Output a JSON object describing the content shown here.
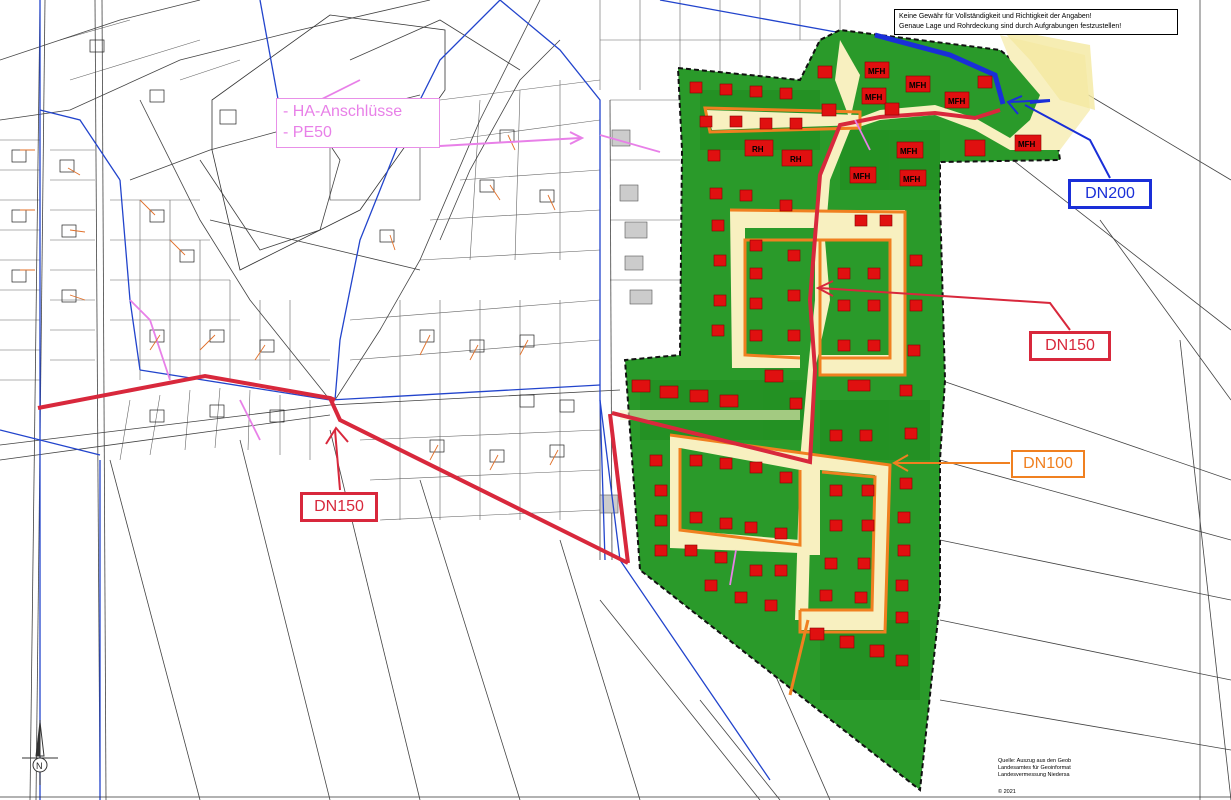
{
  "disclaimer": {
    "line1": "Keine Gewähr für Vollständigkeit und Richtigkeit der Angaben!",
    "line2": "Genaue Lage und Rohrdeckung sind durch Aufgrabungen festzustellen!"
  },
  "legend_ha": {
    "line1": "- HA-Anschlüsse",
    "line2": "- PE50"
  },
  "pipe_labels": {
    "dn200": "DN200",
    "dn150_east": "DN150",
    "dn150_west": "DN150",
    "dn100": "DN100"
  },
  "building_labels": {
    "mfh": "MFH",
    "rh": "RH"
  },
  "north_arrow": "N",
  "source": {
    "line1": "Quelle: Auszug aus den Geob",
    "line2": "Landesamtes für Geoinformat",
    "line3": "Landesvermessung Niedersa"
  },
  "copyright": "© 2021",
  "colors": {
    "development_area": "#2a9a2a",
    "road": "#f8f0c0",
    "dn200": "#1a2fd8",
    "dn150": "#d8283c",
    "dn100": "#f08020",
    "ha_pe50": "#e880e8",
    "building": "#e01010"
  }
}
